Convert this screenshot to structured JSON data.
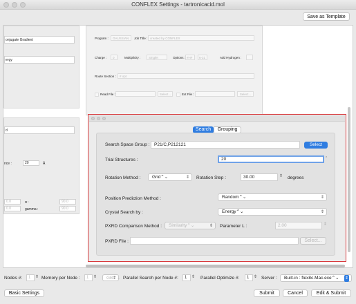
{
  "window": {
    "title": "CONFLEX Settings - tartronicacid.mol"
  },
  "toolbar": {
    "save_template": "Save as Template"
  },
  "left_panel": {
    "opt_label": "onjugate Gradient",
    "energy_label": "ergy",
    "d_label": "d",
    "nce_label": "nce :",
    "nce_value": "20",
    "angstrom": "Å",
    "a_label": "ɑ :",
    "gamma_label": "gamma :",
    "v1": "0.0",
    "v2": "0.0",
    "v3": "90.0",
    "v4": "90.0"
  },
  "bg_form": {
    "program_label": "Program :",
    "program_value": "GAUSSIAN",
    "jobtitle_label": "Job Title :",
    "jobtitle_value": "created by CONFLEX",
    "charge_label": "Charge :",
    "charge_value": "0",
    "multiplicity_label": "Multiplicity :",
    "multiplicity_value": "Singlet",
    "options_label": "Options :",
    "options_value": "#HF",
    "basis_value": "6-31",
    "addhydrogen_label": "Add Hydrogen :",
    "route_label": "Route Section :",
    "route_value": "# opt",
    "readfile_label": "Read File :",
    "select1": "Select...",
    "extfile_label": "Ext File :",
    "select2": "Select..."
  },
  "crystal": {
    "tabs": [
      "Search",
      "Grouping"
    ],
    "space_group_label": "Search Space Group :",
    "space_group_value": "P21/C,P212121",
    "select_label": "Select",
    "trial_label": "Trial Structures :",
    "trial_value": "20",
    "rotation_method_label": "Rotation Method :",
    "rotation_method_value": "Grid",
    "rotation_step_label": "Rotation Step :",
    "rotation_step_value": "30.00",
    "degrees": "degrees",
    "position_label": "Position Prediction Method :",
    "position_value": "Random",
    "crystal_search_label": "Crystal Search by :",
    "crystal_search_value": "Energy",
    "pxrd_method_label": "PXRD Comparison Method :",
    "pxrd_method_value": "Similarity",
    "parameter_l_label": "Parameter L :",
    "parameter_l_value": "2.00",
    "pxrd_file_label": "PXRD File :",
    "pxrd_file_select": "Select..."
  },
  "bottom": {
    "nodes_label": "Nodes #:",
    "nodes_value": "1",
    "memory_label": "Memory per Node :",
    "memory_value": "1",
    "memory_unit": "GB",
    "parallel_search_label": "Parallel Search per Node #:",
    "parallel_search_value": "1",
    "parallel_opt_label": "Parallel Optimize #:",
    "parallel_opt_value": "1",
    "server_label": "Server :",
    "server_value": "Built-in : flex8c.Mac.exe",
    "basic_settings": "Basic Settings",
    "submit": "Submit",
    "cancel": "Cancel",
    "edit_submit": "Edit & Submit"
  }
}
